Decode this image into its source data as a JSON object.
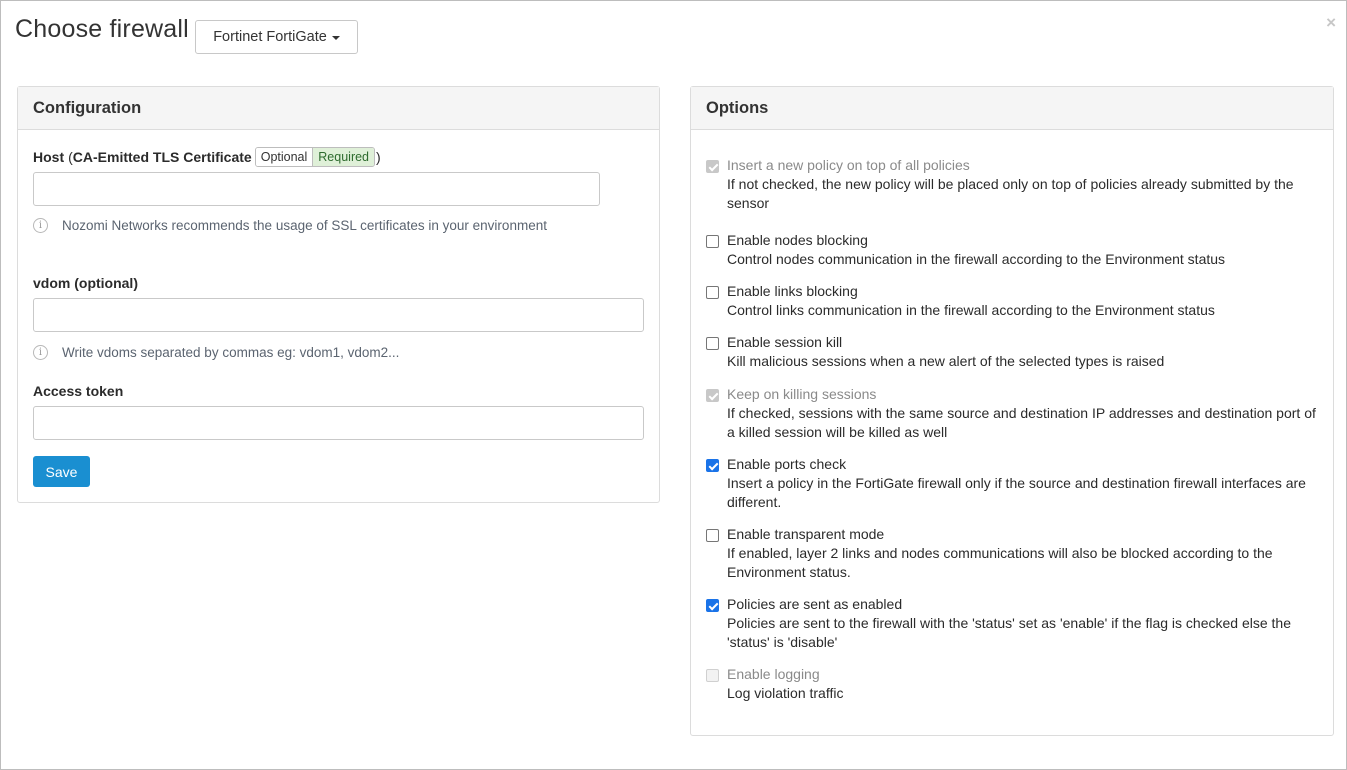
{
  "header": {
    "title": "Choose firewall",
    "firewall_selected": "Fortinet FortiGate",
    "close_symbol": "×"
  },
  "configuration": {
    "panel_title": "Configuration",
    "host": {
      "label": "Host",
      "paren_open": "(",
      "cert_label": "CA-Emitted TLS Certificate",
      "option_optional": "Optional",
      "option_required": "Required",
      "paren_close": ")",
      "value": "",
      "hint": "Nozomi Networks recommends the usage of SSL certificates in your environment"
    },
    "vdom": {
      "label": "vdom (optional)",
      "value": "",
      "hint": "Write vdoms separated by commas eg: vdom1, vdom2..."
    },
    "token": {
      "label": "Access token",
      "value": ""
    },
    "save_label": "Save",
    "info_icon": "i"
  },
  "options": {
    "panel_title": "Options",
    "items": [
      {
        "title": "Insert a new policy on top of all policies",
        "desc": "If not checked, the new policy will be placed only on top of policies already submitted by the sensor",
        "checked": true,
        "disabled": true
      },
      {
        "title": "Enable nodes blocking",
        "desc": "Control nodes communication in the firewall according to the Environment status",
        "checked": false,
        "disabled": false
      },
      {
        "title": "Enable links blocking",
        "desc": "Control links communication in the firewall according to the Environment status",
        "checked": false,
        "disabled": false
      },
      {
        "title": "Enable session kill",
        "desc": "Kill malicious sessions when a new alert of the selected types is raised",
        "checked": false,
        "disabled": false
      },
      {
        "title": "Keep on killing sessions",
        "desc": "If checked, sessions with the same source and destination IP addresses and destination port of a killed session will be killed as well",
        "checked": true,
        "disabled": true
      },
      {
        "title": "Enable ports check",
        "desc": "Insert a policy in the FortiGate firewall only if the source and destination firewall interfaces are different.",
        "checked": true,
        "disabled": false
      },
      {
        "title": "Enable transparent mode",
        "desc": "If enabled, layer 2 links and nodes communications will also be blocked according to the Environment status.",
        "checked": false,
        "disabled": false
      },
      {
        "title": "Policies are sent as enabled",
        "desc": "Policies are sent to the firewall with the 'status' set as 'enable' if the flag is checked else the 'status' is 'disable'",
        "checked": true,
        "disabled": false
      },
      {
        "title": "Enable logging",
        "desc": "Log violation traffic",
        "checked": false,
        "disabled": true
      }
    ]
  },
  "colors": {
    "primary": "#1a8fd1",
    "checkbox_checked": "#1a73e8",
    "required_bg": "#dff0d8",
    "panel_header_bg": "#f5f5f5"
  }
}
